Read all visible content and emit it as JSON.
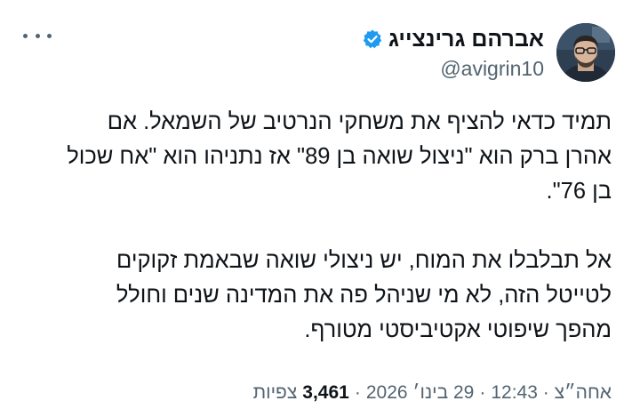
{
  "author": {
    "display_name": "אברהם גרינצייג",
    "handle": "@avigrin10",
    "verified_icon": "verified-badge-icon",
    "verified_color": "#1d9bf0"
  },
  "menu": {
    "icon": "more-options-icon"
  },
  "tweet": {
    "lines": [
      "תמיד כדאי להציף את משחקי הנרטיב של השמאל. אם",
      "אהרן ברק הוא \"ניצול שואה בן 89\" אז נתניהו הוא \"אח שכול",
      "בן 76\".",
      "",
      "אל תבלבלו את המוח, יש ניצולי שואה שבאמת זקוקים",
      "לטייטל הזה, לא מי שניהל פה את המדינה שנים וחולל",
      "מהפך שיפוטי אקטיביסטי מטורף."
    ]
  },
  "meta": {
    "time": "אחה״צ · 12:43",
    "date": "29 בינו׳ 2026",
    "separator": "·",
    "views_count": "3,461",
    "views_label": "צפיות"
  }
}
